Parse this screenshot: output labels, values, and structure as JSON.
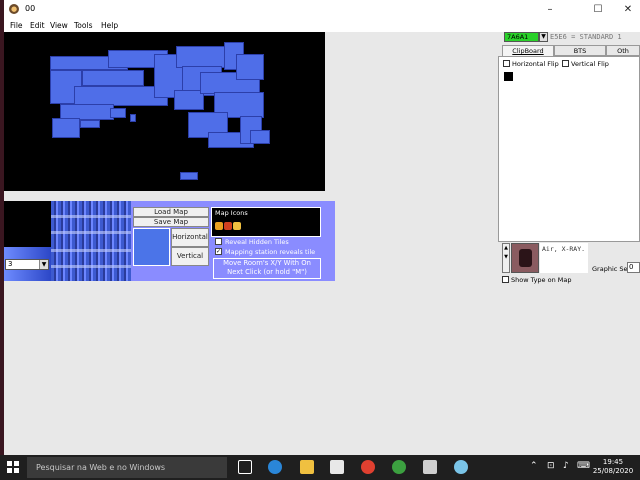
{
  "window": {
    "title": "00",
    "icon": "app-icon",
    "controls": [
      "minimize-icon",
      "maximize-icon",
      "close-icon"
    ]
  },
  "menu": [
    "File",
    "Edit",
    "View",
    "Tools",
    "Help"
  ],
  "toolbar": {
    "area_combo_value": "3",
    "load_map": "Load Map",
    "save_map": "Save Map",
    "horizontal": "Horizontal",
    "vertical": "Vertical",
    "map_icons_label": "Map Icons",
    "reveal_hidden_tiles": "Reveal Hidden Tiles",
    "reveal_hidden_tiles_checked": false,
    "mapping_station": "Mapping station reveals tile",
    "mapping_station_checked": true,
    "move_room_line1": "Move  Room's X/Y With On",
    "move_room_line2": "Next Click (or hold \"M\")",
    "colors": {
      "panel": "#8a8cff",
      "room": "#4f6ee8"
    }
  },
  "right_panel": {
    "selector_value": "7A6A1",
    "mode_text": "E5E6 = STANDARD 1",
    "tabs": [
      "ClipBoard",
      "BTS",
      "Oth"
    ],
    "active_tab": "ClipBoard",
    "horizontal_flip": "Horizontal Flip",
    "vertical_flip": "Vertical Flip",
    "sprite_desc": "Air, X-RAY.",
    "graphic_set_label": "Graphic Set",
    "graphic_set_value": "0",
    "show_type_on_map": "Show Type on Map",
    "selector_color": "#2ad12a"
  },
  "taskbar": {
    "search_placeholder": "Pesquisar na Web e no Windows",
    "time": "19:45",
    "date": "25/08/2020",
    "apps": [
      "task-view-icon",
      "edge-icon",
      "file-explorer-icon",
      "store-icon",
      "chrome-icon",
      "game-icon",
      "photos-icon",
      "paint-icon"
    ]
  }
}
